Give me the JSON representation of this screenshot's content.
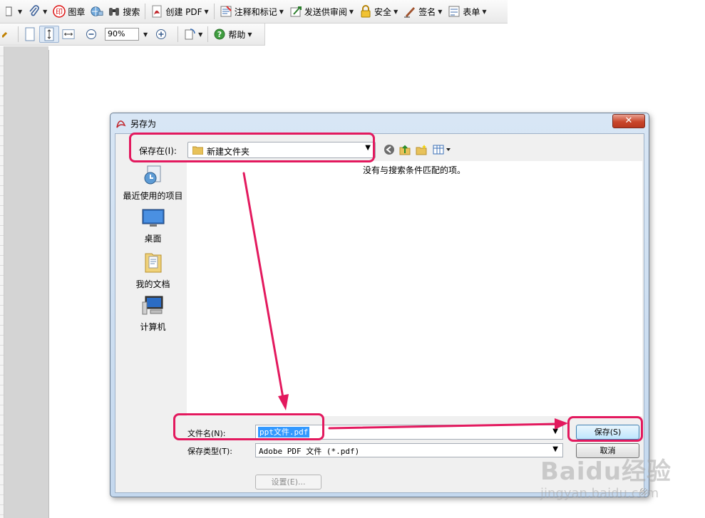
{
  "toolbar_top": {
    "stamp_label": "图章",
    "search_label": "搜索",
    "create_pdf_label": "创建 PDF",
    "comment_label": "注释和标记",
    "review_label": "发送供审阅",
    "security_label": "安全",
    "sign_label": "签名",
    "forms_label": "表单"
  },
  "toolbar_second": {
    "zoom_value": "90%",
    "help_label": "帮助"
  },
  "dialog": {
    "title": "另存为",
    "close_glyph": "✕",
    "save_in_label": "保存在(I):",
    "save_in_value": "新建文件夹",
    "places": [
      {
        "label": "最近使用的项目",
        "icon": "recent-items-icon"
      },
      {
        "label": "桌面",
        "icon": "desktop-icon"
      },
      {
        "label": "我的文档",
        "icon": "documents-icon"
      },
      {
        "label": "计算机",
        "icon": "computer-icon"
      }
    ],
    "empty_message": "没有与搜索条件匹配的项。",
    "filename_label": "文件名(N):",
    "filename_value": "ppt文件.pdf",
    "filetype_label": "保存类型(T):",
    "filetype_value": "Adobe PDF 文件 (*.pdf)",
    "save_button": "保存(S)",
    "cancel_button": "取消",
    "settings_button": "设置(E)..."
  },
  "annotation_color": "#e3195e",
  "watermark": {
    "logo": "Baidu经验",
    "url": "jingyan.baidu.com"
  }
}
